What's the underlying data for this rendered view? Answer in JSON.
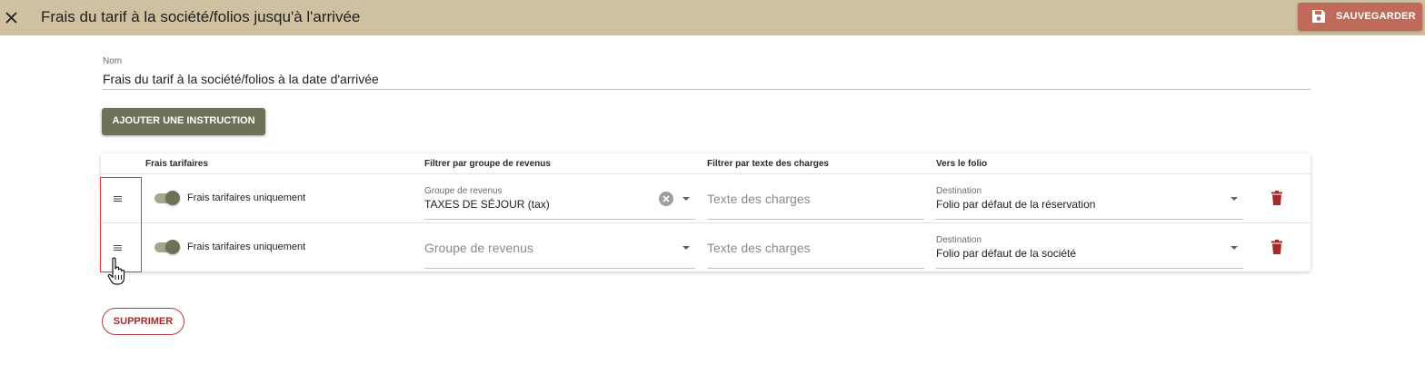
{
  "header": {
    "title": "Frais du tarif à la société/folios jusqu'à l'arrivée",
    "save_label": "SAUVEGARDER",
    "background": "#cfc1a0",
    "save_color": "#c06a5a"
  },
  "form": {
    "name_label": "Nom",
    "name_value": "Frais du tarif à la société/folios à la date d'arrivée",
    "add_instruction_label": "AJOUTER UNE INSTRUCTION",
    "delete_label": "SUPPRIMER"
  },
  "table": {
    "headers": {
      "rate_charges": "Frais tarifaires",
      "revenue_group": "Filtrer par groupe de revenus",
      "charge_text": "Filtrer par texte des charges",
      "to_folio": "Vers le folio"
    },
    "rows": [
      {
        "toggle_label": "Frais tarifaires uniquement",
        "toggle_on": true,
        "revenue_group_label": "Groupe de revenus",
        "revenue_group_value": "TAXES DE SÉJOUR (tax)",
        "charge_text_placeholder": "Texte des charges",
        "destination_label": "Destination",
        "destination_value": "Folio par défaut de la réservation"
      },
      {
        "toggle_label": "Frais tarifaires uniquement",
        "toggle_on": true,
        "revenue_group_placeholder": "Groupe de revenus",
        "charge_text_placeholder": "Texte des charges",
        "destination_label": "Destination",
        "destination_value": "Folio par défaut de la société"
      }
    ]
  },
  "colors": {
    "primary": "#6e7158",
    "danger": "#a52a2a",
    "highlight": "#e53935"
  }
}
